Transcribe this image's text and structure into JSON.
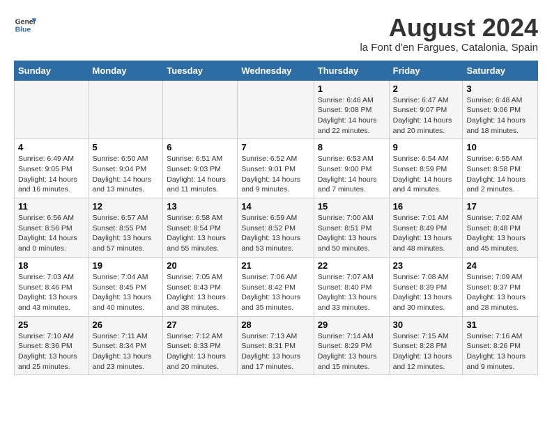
{
  "header": {
    "logo_line1": "General",
    "logo_line2": "Blue",
    "title": "August 2024",
    "subtitle": "la Font d'en Fargues, Catalonia, Spain"
  },
  "days_of_week": [
    "Sunday",
    "Monday",
    "Tuesday",
    "Wednesday",
    "Thursday",
    "Friday",
    "Saturday"
  ],
  "weeks": [
    [
      {
        "day": "",
        "info": ""
      },
      {
        "day": "",
        "info": ""
      },
      {
        "day": "",
        "info": ""
      },
      {
        "day": "",
        "info": ""
      },
      {
        "day": "1",
        "info": "Sunrise: 6:46 AM\nSunset: 9:08 PM\nDaylight: 14 hours\nand 22 minutes."
      },
      {
        "day": "2",
        "info": "Sunrise: 6:47 AM\nSunset: 9:07 PM\nDaylight: 14 hours\nand 20 minutes."
      },
      {
        "day": "3",
        "info": "Sunrise: 6:48 AM\nSunset: 9:06 PM\nDaylight: 14 hours\nand 18 minutes."
      }
    ],
    [
      {
        "day": "4",
        "info": "Sunrise: 6:49 AM\nSunset: 9:05 PM\nDaylight: 14 hours\nand 16 minutes."
      },
      {
        "day": "5",
        "info": "Sunrise: 6:50 AM\nSunset: 9:04 PM\nDaylight: 14 hours\nand 13 minutes."
      },
      {
        "day": "6",
        "info": "Sunrise: 6:51 AM\nSunset: 9:03 PM\nDaylight: 14 hours\nand 11 minutes."
      },
      {
        "day": "7",
        "info": "Sunrise: 6:52 AM\nSunset: 9:01 PM\nDaylight: 14 hours\nand 9 minutes."
      },
      {
        "day": "8",
        "info": "Sunrise: 6:53 AM\nSunset: 9:00 PM\nDaylight: 14 hours\nand 7 minutes."
      },
      {
        "day": "9",
        "info": "Sunrise: 6:54 AM\nSunset: 8:59 PM\nDaylight: 14 hours\nand 4 minutes."
      },
      {
        "day": "10",
        "info": "Sunrise: 6:55 AM\nSunset: 8:58 PM\nDaylight: 14 hours\nand 2 minutes."
      }
    ],
    [
      {
        "day": "11",
        "info": "Sunrise: 6:56 AM\nSunset: 8:56 PM\nDaylight: 14 hours\nand 0 minutes."
      },
      {
        "day": "12",
        "info": "Sunrise: 6:57 AM\nSunset: 8:55 PM\nDaylight: 13 hours\nand 57 minutes."
      },
      {
        "day": "13",
        "info": "Sunrise: 6:58 AM\nSunset: 8:54 PM\nDaylight: 13 hours\nand 55 minutes."
      },
      {
        "day": "14",
        "info": "Sunrise: 6:59 AM\nSunset: 8:52 PM\nDaylight: 13 hours\nand 53 minutes."
      },
      {
        "day": "15",
        "info": "Sunrise: 7:00 AM\nSunset: 8:51 PM\nDaylight: 13 hours\nand 50 minutes."
      },
      {
        "day": "16",
        "info": "Sunrise: 7:01 AM\nSunset: 8:49 PM\nDaylight: 13 hours\nand 48 minutes."
      },
      {
        "day": "17",
        "info": "Sunrise: 7:02 AM\nSunset: 8:48 PM\nDaylight: 13 hours\nand 45 minutes."
      }
    ],
    [
      {
        "day": "18",
        "info": "Sunrise: 7:03 AM\nSunset: 8:46 PM\nDaylight: 13 hours\nand 43 minutes."
      },
      {
        "day": "19",
        "info": "Sunrise: 7:04 AM\nSunset: 8:45 PM\nDaylight: 13 hours\nand 40 minutes."
      },
      {
        "day": "20",
        "info": "Sunrise: 7:05 AM\nSunset: 8:43 PM\nDaylight: 13 hours\nand 38 minutes."
      },
      {
        "day": "21",
        "info": "Sunrise: 7:06 AM\nSunset: 8:42 PM\nDaylight: 13 hours\nand 35 minutes."
      },
      {
        "day": "22",
        "info": "Sunrise: 7:07 AM\nSunset: 8:40 PM\nDaylight: 13 hours\nand 33 minutes."
      },
      {
        "day": "23",
        "info": "Sunrise: 7:08 AM\nSunset: 8:39 PM\nDaylight: 13 hours\nand 30 minutes."
      },
      {
        "day": "24",
        "info": "Sunrise: 7:09 AM\nSunset: 8:37 PM\nDaylight: 13 hours\nand 28 minutes."
      }
    ],
    [
      {
        "day": "25",
        "info": "Sunrise: 7:10 AM\nSunset: 8:36 PM\nDaylight: 13 hours\nand 25 minutes."
      },
      {
        "day": "26",
        "info": "Sunrise: 7:11 AM\nSunset: 8:34 PM\nDaylight: 13 hours\nand 23 minutes."
      },
      {
        "day": "27",
        "info": "Sunrise: 7:12 AM\nSunset: 8:33 PM\nDaylight: 13 hours\nand 20 minutes."
      },
      {
        "day": "28",
        "info": "Sunrise: 7:13 AM\nSunset: 8:31 PM\nDaylight: 13 hours\nand 17 minutes."
      },
      {
        "day": "29",
        "info": "Sunrise: 7:14 AM\nSunset: 8:29 PM\nDaylight: 13 hours\nand 15 minutes."
      },
      {
        "day": "30",
        "info": "Sunrise: 7:15 AM\nSunset: 8:28 PM\nDaylight: 13 hours\nand 12 minutes."
      },
      {
        "day": "31",
        "info": "Sunrise: 7:16 AM\nSunset: 8:26 PM\nDaylight: 13 hours\nand 9 minutes."
      }
    ]
  ]
}
